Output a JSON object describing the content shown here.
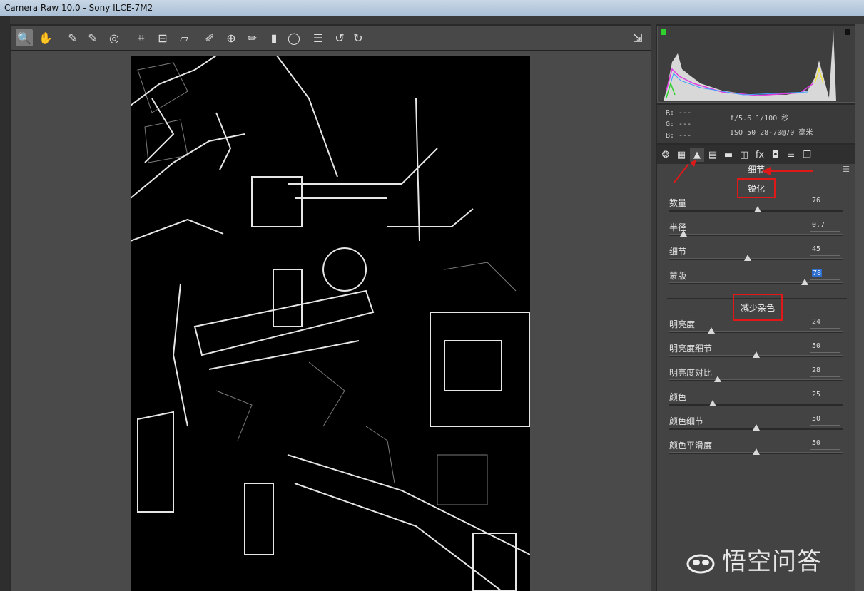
{
  "window": {
    "title": "Camera Raw 10.0  -  Sony ILCE-7M2"
  },
  "toolbar": {
    "tools": [
      {
        "icon": "zoom-icon",
        "glyph": "🔍"
      },
      {
        "icon": "hand-icon",
        "glyph": "✋"
      },
      {
        "icon": "white-balance-icon",
        "glyph": "✎"
      },
      {
        "icon": "color-sampler-icon",
        "glyph": "✎"
      },
      {
        "icon": "targeted-adjustment-icon",
        "glyph": "◎"
      },
      {
        "icon": "crop-icon",
        "glyph": "⌗"
      },
      {
        "icon": "straighten-icon",
        "glyph": "⊟"
      },
      {
        "icon": "transform-icon",
        "glyph": "▱"
      },
      {
        "icon": "spot-removal-icon",
        "glyph": "✐"
      },
      {
        "icon": "red-eye-icon",
        "glyph": "⊕"
      },
      {
        "icon": "adjustment-brush-icon",
        "glyph": "✏"
      },
      {
        "icon": "graduated-filter-icon",
        "glyph": "▮"
      },
      {
        "icon": "radial-filter-icon",
        "glyph": "◯"
      },
      {
        "icon": "preferences-icon",
        "glyph": "☰"
      },
      {
        "icon": "rotate-ccw-icon",
        "glyph": "↺"
      },
      {
        "icon": "rotate-cw-icon",
        "glyph": "↻"
      }
    ],
    "fullscreen_icon": "⇲"
  },
  "camera_info": {
    "r": "R:  ---",
    "g": "G:  ---",
    "b": "B:  ---",
    "exposure": "f/5.6   1/100 秒",
    "lens": "ISO 50   28-70@70 毫米"
  },
  "tabs": [
    {
      "icon": "basic-icon",
      "glyph": "❂"
    },
    {
      "icon": "tone-curve-icon",
      "glyph": "▦"
    },
    {
      "icon": "detail-icon",
      "glyph": "▲"
    },
    {
      "icon": "hsl-icon",
      "glyph": "▤"
    },
    {
      "icon": "split-toning-icon",
      "glyph": "▬"
    },
    {
      "icon": "lens-corrections-icon",
      "glyph": "◫"
    },
    {
      "icon": "effects-icon",
      "glyph": "fx"
    },
    {
      "icon": "camera-calibration-icon",
      "glyph": "◘"
    },
    {
      "icon": "presets-icon",
      "glyph": "≡"
    },
    {
      "icon": "snapshots-icon",
      "glyph": "❐"
    }
  ],
  "panel": {
    "title": "细节",
    "sharpening": {
      "heading": "锐化",
      "rows": [
        {
          "label": "数量",
          "value": "76",
          "fraction": 0.51
        },
        {
          "label": "半径",
          "value": "0.7",
          "fraction": 0.08
        },
        {
          "label": "细节",
          "value": "45",
          "fraction": 0.45
        },
        {
          "label": "蒙版",
          "value": "78",
          "fraction": 0.78
        }
      ]
    },
    "noise": {
      "heading": "减少杂色",
      "rows": [
        {
          "label": "明亮度",
          "value": "24",
          "fraction": 0.24
        },
        {
          "label": "明亮度细节",
          "value": "50",
          "fraction": 0.5
        },
        {
          "label": "明亮度对比",
          "value": "28",
          "fraction": 0.28
        },
        {
          "label": "颜色",
          "value": "25",
          "fraction": 0.25
        },
        {
          "label": "颜色细节",
          "value": "50",
          "fraction": 0.5
        },
        {
          "label": "颜色平滑度",
          "value": "50",
          "fraction": 0.5
        }
      ]
    }
  },
  "watermark": {
    "text": "悟空问答"
  }
}
